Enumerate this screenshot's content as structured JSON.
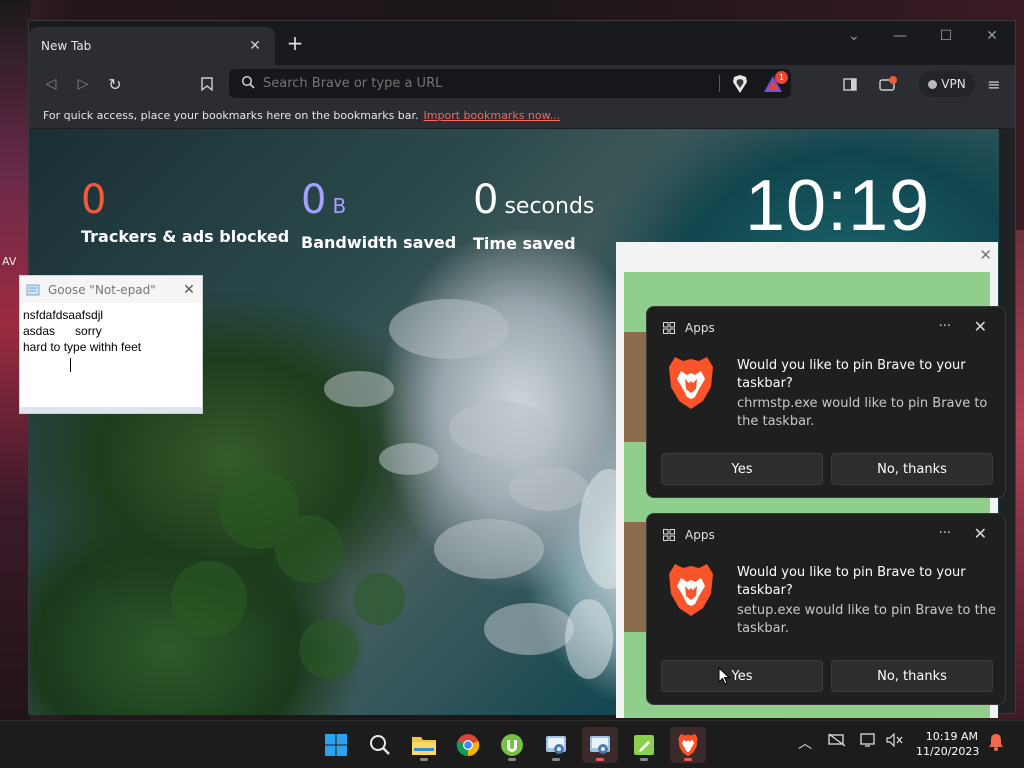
{
  "desktop": {
    "left_text": "AV"
  },
  "browser": {
    "tab_title": "New Tab",
    "search_placeholder": "Search Brave or type a URL",
    "rewards_badge": "1",
    "vpn_label": "VPN",
    "bookmarks_message": "For quick access, place your bookmarks here on the bookmarks bar.",
    "bookmarks_link": "Import bookmarks now..."
  },
  "ntp": {
    "stats": [
      {
        "value": "0",
        "unit": "",
        "label": "Trackers & ads blocked",
        "color": "#f15b39"
      },
      {
        "value": "0",
        "unit": "B",
        "label": "Bandwidth saved",
        "color": "#a59fff"
      },
      {
        "value": "0",
        "unit": "seconds",
        "label": "Time saved",
        "color": "#ffffff"
      }
    ],
    "clock": "10:19"
  },
  "notepad": {
    "title": "Goose \"Not-epad\"",
    "lines": [
      "nsfdafdsaafsdjl",
      "asdas      sorry",
      "hard to type withh feet"
    ]
  },
  "notifications": [
    {
      "app": "Apps",
      "title": "Would you like to pin Brave to your taskbar?",
      "message": "chrmstp.exe would like to pin Brave to the taskbar.",
      "yes": "Yes",
      "no": "No, thanks"
    },
    {
      "app": "Apps",
      "title": "Would you like to pin Brave to your taskbar?",
      "message": "setup.exe would like to pin Brave to the taskbar.",
      "yes": "Yes",
      "no": "No, thanks"
    }
  ],
  "taskbar": {
    "time": "10:19 AM",
    "date": "11/20/2023",
    "apps": [
      "windows-start-icon",
      "search-icon",
      "file-explorer-icon",
      "chrome-icon",
      "utorrent-icon",
      "control-panel-icon",
      "control-panel-icon",
      "notepad-app-icon",
      "brave-icon"
    ]
  },
  "colors": {
    "accent_orange": "#f15b39",
    "link_red": "#f16a62",
    "brave_orange": "#fb542b"
  }
}
